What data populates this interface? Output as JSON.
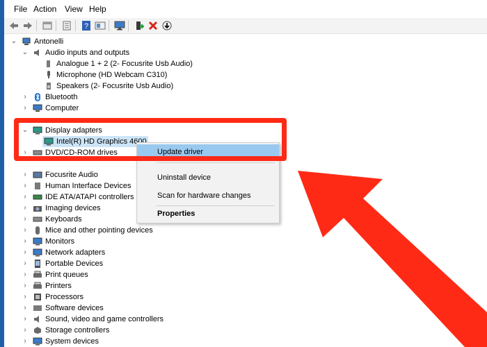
{
  "menu": [
    "File",
    "Action",
    "View",
    "Help"
  ],
  "root": "Antonelli",
  "audio": {
    "label": "Audio inputs and outputs",
    "children": [
      "Analogue 1 + 2 (2- Focusrite Usb Audio)",
      "Microphone (HD Webcam C310)",
      "Speakers (2- Focusrite Usb Audio)"
    ]
  },
  "categories_top": [
    "Bluetooth",
    "Computer"
  ],
  "display": {
    "label": "Display adapters",
    "child": "Intel(R) HD Graphics 4600"
  },
  "dvd": "DVD/CD-ROM drives",
  "categories_bottom": [
    "Focusrite Audio",
    "Human Interface Devices",
    "IDE ATA/ATAPI controllers",
    "Imaging devices",
    "Keyboards",
    "Mice and other pointing devices",
    "Monitors",
    "Network adapters",
    "Portable Devices",
    "Print queues",
    "Printers",
    "Processors",
    "Software devices",
    "Sound, video and game controllers",
    "Storage controllers",
    "System devices"
  ],
  "context_menu": {
    "update": "Update driver",
    "uninstall": "Uninstall device",
    "scan": "Scan for hardware changes",
    "properties": "Properties"
  },
  "colors": {
    "highlight_border": "#ff2a16",
    "menu_selected": "#99c9ef",
    "tree_selected": "#cce4f7"
  },
  "icons": {
    "toolbar": [
      "back-arrow-icon",
      "forward-arrow-icon",
      "properties-icon",
      "list-icon",
      "help-icon",
      "view-icon",
      "monitor-icon",
      "add-driver-icon",
      "remove-icon",
      "download-icon"
    ]
  }
}
